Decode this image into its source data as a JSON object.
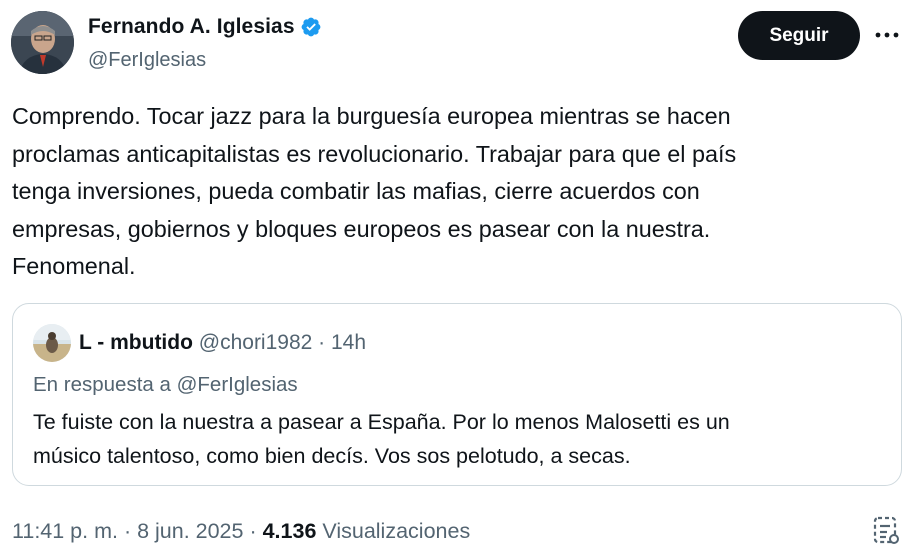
{
  "author": {
    "name": "Fernando A. Iglesias",
    "handle": "@FerIglesias",
    "verified": true,
    "avatar_icon": "profile-photo"
  },
  "actions": {
    "follow_label": "Seguir",
    "more_icon": "ellipsis-icon"
  },
  "tweet": {
    "lines": [
      "Comprendo. Tocar jazz para la burguesía europea mientras se hacen",
      "proclamas anticapitalistas es revolucionario. Trabajar para que el país",
      "tenga inversiones, pueda combatir las mafias, cierre acuerdos con",
      "empresas, gobiernos y bloques europeos es pasear con la nuestra.",
      "Fenomenal."
    ]
  },
  "quote": {
    "name": "L - mbutido",
    "handle": "@chori1982",
    "time": "14h",
    "separator": " · ",
    "reply_to": "En respuesta a @FerIglesias",
    "lines": [
      "Te fuiste con la nuestra a pasear a España. Por lo menos Malosetti es un",
      "músico talentoso, como bien decís. Vos sos pelotudo, a secas."
    ]
  },
  "meta": {
    "time": "11:41 p. m.",
    "separator": " · ",
    "date": "8 jun. 2025",
    "views_count": "4.136",
    "views_label": "Visualizaciones"
  },
  "colors": {
    "text": "#0f1419",
    "secondary": "#536471",
    "border": "#cfd9de",
    "verified": "#1d9bf0",
    "button_bg": "#0f1419"
  }
}
